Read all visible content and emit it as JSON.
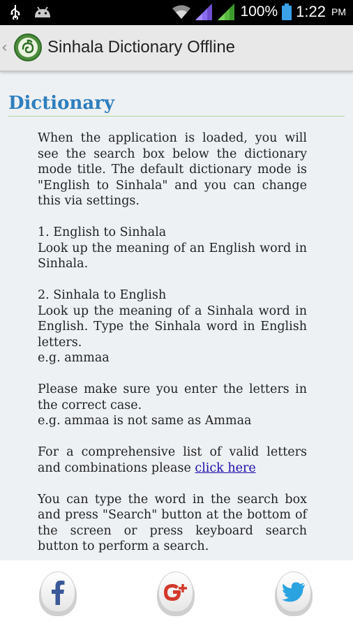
{
  "status_bar": {
    "battery": "100%",
    "time": "1:22",
    "ampm": "PM"
  },
  "action_bar": {
    "title": "Sinhala Dictionary Offline"
  },
  "content": {
    "section_title": "Dictionary",
    "intro": "When the application is loaded, you will see the search box below the dictionary mode title. The default dictionary mode is \"English to Sinhala\" and you can change this via settings.",
    "mode1_title": "1. English to Sinhala",
    "mode1_desc": "Look up the meaning of an English word in Sinhala.",
    "mode2_title": "2. Sinhala to English",
    "mode2_desc": "Look up the meaning of a Sinhala word in English. Type the Sinhala word in English letters.",
    "mode2_example": "e.g. ammaa",
    "case_note": "Please make sure you enter the letters in the correct case.",
    "case_example": "e.g. ammaa is not same as Ammaa",
    "letters_text": "For a comprehensive list of valid letters and combinations please",
    "letters_link": "click here",
    "search_tip": "You can type the word in the search box and press \"Search\" button at the bottom of the screen or press keyboard search button to perform a search."
  },
  "share_bar": {
    "buttons": [
      {
        "icon": "facebook-icon",
        "color": "#3b5998"
      },
      {
        "icon": "google-plus-icon",
        "color": "#d23a2c"
      },
      {
        "icon": "twitter-icon",
        "color": "#2aa3e0"
      }
    ]
  }
}
